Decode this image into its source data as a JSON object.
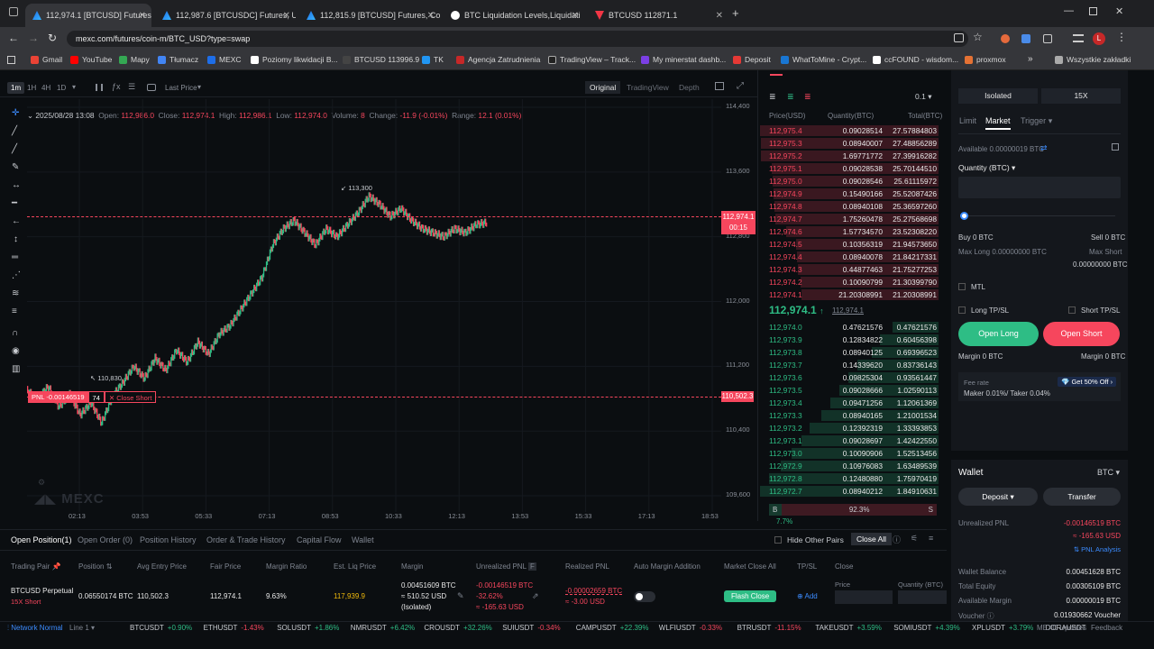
{
  "browser": {
    "tabs": [
      {
        "label": "112,974.1 [BTCUSD] Futures, Co",
        "icon": "mexc-icon",
        "active": true
      },
      {
        "label": "112,987.6 [BTCUSDC] Futures, U",
        "icon": "mexc-icon",
        "active": false
      },
      {
        "label": "112,815.9 [BTCUSD] Futures, Co",
        "icon": "mexc-icon",
        "active": false
      },
      {
        "label": "BTC Liquidation Levels,Liquidati",
        "icon": "coinglass-icon",
        "active": false
      },
      {
        "label": "BTCUSD 112871.1",
        "icon": "tradingview-icon",
        "active": false
      }
    ],
    "url": "mexc.com/futures/coin-m/BTC_USD?type=swap",
    "bookmarks": [
      "Gmail",
      "YouTube",
      "Mapy",
      "Tłumacz",
      "MEXC",
      "Poziomy likwidacji B...",
      "BTCUSD 113996.9",
      "TK",
      "Agencja Zatrudnienia",
      "TradingView – Track...",
      "My minerstat dashb...",
      "Deposit",
      "WhatToMine - Crypt...",
      "ccFOUND - wisdom...",
      "proxmox"
    ],
    "bookmarks_folder": "Wszystkie zakładki"
  },
  "chart": {
    "toolbar": {
      "intervals": [
        "1m",
        "1H",
        "4H",
        "1D"
      ],
      "price_type": "Last Price",
      "views": [
        "Original",
        "TradingView",
        "Depth"
      ]
    },
    "ohlc": {
      "date": "2025/08/28 13:08",
      "open_label": "Open:",
      "open": "112,986.0",
      "close_label": "Close:",
      "close": "112,974.1",
      "high_label": "High:",
      "high": "112,986.1",
      "low_label": "Low:",
      "low": "112,974.0",
      "volume_label": "Volume:",
      "volume": "8",
      "change_label": "Change:",
      "change": "-11.9 (-0.01%)",
      "range_label": "Range:",
      "range": "12.1 (0.01%)"
    },
    "current_price": "112,974.1",
    "countdown": "00:15",
    "high_label": "113,300",
    "low_label": "110,830",
    "position_line": {
      "pnl": "PNL -0.00146519",
      "qty": "74",
      "action": "Close Short",
      "price": "110,502.3"
    },
    "watermark": "MEXC",
    "chart_data": {
      "type": "line",
      "ylim": [
        109400,
        114500
      ],
      "y_ticks": [
        "114,400",
        "113,600",
        "112,800",
        "112,000",
        "111,200",
        "110,400",
        "109,600"
      ],
      "x_ticks": [
        "02:13",
        "03:53",
        "05:33",
        "07:13",
        "08:53",
        "10:33",
        "12:13",
        "13:53",
        "15:33",
        "17:13",
        "18:53"
      ],
      "y": [
        110900,
        110800,
        110950,
        110700,
        110850,
        110600,
        110750,
        110500,
        110830,
        111000,
        111200,
        111050,
        111300,
        111150,
        111400,
        111250,
        111500,
        111350,
        111600,
        111700,
        111900,
        112100,
        112300,
        112700,
        112900,
        113000,
        112850,
        112700,
        112900,
        112800,
        112950,
        113100,
        113300,
        113200,
        113050,
        113150,
        113000,
        112900,
        112850,
        112800,
        112900,
        112850,
        112950,
        112974
      ]
    },
    "colors": {
      "up": "#2ebd85",
      "down": "#f6465d"
    }
  },
  "orderbook": {
    "step": "0.1",
    "headers": [
      "Price(USD)",
      "Quantity(BTC)",
      "Total(BTC)"
    ],
    "asks": [
      [
        "112,975.4",
        "0.09028514",
        "27.57884803"
      ],
      [
        "112,975.3",
        "0.08940007",
        "27.48856289"
      ],
      [
        "112,975.2",
        "1.69771772",
        "27.39916282"
      ],
      [
        "112,975.1",
        "0.09028538",
        "25.70144510"
      ],
      [
        "112,975.0",
        "0.09028546",
        "25.61115972"
      ],
      [
        "112,974.9",
        "0.15490166",
        "25.52087426"
      ],
      [
        "112,974.8",
        "0.08940108",
        "25.36597260"
      ],
      [
        "112,974.7",
        "1.75260478",
        "25.27568698"
      ],
      [
        "112,974.6",
        "1.57734570",
        "23.52308220"
      ],
      [
        "112,974.5",
        "0.10356319",
        "21.94573650"
      ],
      [
        "112,974.4",
        "0.08940078",
        "21.84217331"
      ],
      [
        "112,974.3",
        "0.44877463",
        "21.75277253"
      ],
      [
        "112,974.2",
        "0.10090799",
        "21.30399790"
      ],
      [
        "112,974.1",
        "21.20308991",
        "21.20308991"
      ]
    ],
    "last_price": "112,974.1",
    "mark_price": "112,974.1",
    "bids": [
      [
        "112,974.0",
        "0.47621576",
        "0.47621576"
      ],
      [
        "112,973.9",
        "0.12834822",
        "0.60456398"
      ],
      [
        "112,973.8",
        "0.08940125",
        "0.69396523"
      ],
      [
        "112,973.7",
        "0.14339620",
        "0.83736143"
      ],
      [
        "112,973.6",
        "0.09825304",
        "0.93561447"
      ],
      [
        "112,973.5",
        "0.09028666",
        "1.02590113"
      ],
      [
        "112,973.4",
        "0.09471256",
        "1.12061369"
      ],
      [
        "112,973.3",
        "0.08940165",
        "1.21001534"
      ],
      [
        "112,973.2",
        "0.12392319",
        "1.33393853"
      ],
      [
        "112,973.1",
        "0.09028697",
        "1.42422550"
      ],
      [
        "112,973.0",
        "0.10090906",
        "1.52513456"
      ],
      [
        "112,972.9",
        "0.10976083",
        "1.63489539"
      ],
      [
        "112,972.8",
        "0.12480880",
        "1.75970419"
      ],
      [
        "112,972.7",
        "0.08940212",
        "1.84910631"
      ]
    ],
    "ratio": {
      "buy": "7.7%",
      "sell": "92.3%",
      "buy_label": "B",
      "sell_label": "S",
      "buy_fraction": 0.077
    }
  },
  "trade": {
    "margin_mode": "Isolated",
    "leverage": "15X",
    "order_tabs": [
      "Limit",
      "Market",
      "Trigger"
    ],
    "available": "Available 0.00000019 BTC",
    "quantity_label": "Quantity (BTC)",
    "buy": "Buy 0 BTC",
    "sell": "Sell 0 BTC",
    "max_long": "Max Long 0.00000000 BTC",
    "max_short": "Max Short",
    "max_short_val": "0.00000000 BTC",
    "mtl": "MTL",
    "long_tpsl": "Long TP/SL",
    "short_tpsl": "Short TP/SL",
    "open_long": "Open Long",
    "open_short": "Open Short",
    "margin_long": "Margin 0 BTC",
    "margin_short": "Margin 0 BTC",
    "fee_label": "Fee rate",
    "fee": "Maker 0.01%/ Taker 0.04%",
    "fee_promo": "Get 50% Off"
  },
  "wallet": {
    "title": "Wallet",
    "coin": "BTC",
    "deposit": "Deposit",
    "transfer": "Transfer",
    "rows": [
      {
        "label": "Unrealized PNL",
        "value": "-0.00146519 BTC"
      },
      {
        "label": "",
        "value": "≈ -165.63 USD"
      },
      {
        "label": "",
        "value": "PNL Analysis"
      },
      {
        "label": "Wallet Balance",
        "value": "0.00451628 BTC"
      },
      {
        "label": "Total Equity",
        "value": "0.00305109 BTC"
      },
      {
        "label": "Available Margin",
        "value": "0.00000019 BTC"
      },
      {
        "label": "Voucher",
        "value": "0.01930662 Voucher"
      }
    ]
  },
  "positions": {
    "tabs": [
      "Open Position(1)",
      "Open Order (0)",
      "Position History",
      "Order & Trade History",
      "Capital Flow",
      "Wallet"
    ],
    "hide_other": "Hide Other Pairs",
    "close_all": "Close All",
    "headers": [
      "Trading Pair",
      "Position",
      "Avg Entry Price",
      "Fair Price",
      "Margin Ratio",
      "Est. Liq Price",
      "Margin",
      "Unrealized PNL",
      "Realized PNL",
      "Auto Margin Addition",
      "Market Close All",
      "TP/SL",
      "Close"
    ],
    "row": {
      "pair": "BTCUSD Perpetual",
      "side": "15X Short",
      "position": "0.06550174 BTC",
      "entry": "110,502.3",
      "fair": "112,974.1",
      "ratio": "9.63%",
      "liq": "117,939.9",
      "margin1": "0.00451609 BTC",
      "margin2": "≈ 510.52 USD",
      "margin3": "(Isolated)",
      "upnl1": "-0.00146519 BTC",
      "upnl2": "-32.62%",
      "upnl3": "≈ -165.63 USD",
      "rpnl1": "-0.00002659 BTC",
      "rpnl2": "≈ -3.00 USD",
      "flash": "Flash Close",
      "add": "Add",
      "price_label": "Price",
      "qty_label": "Quantity (BTC)"
    }
  },
  "ticker": {
    "network": "Network Normal",
    "line": "Line 1",
    "items": [
      {
        "s": "BTCUSDT",
        "v": "+0.90%",
        "up": true
      },
      {
        "s": "ETHUSDT",
        "v": "-1.43%",
        "up": false
      },
      {
        "s": "SOLUSDT",
        "v": "+1.86%",
        "up": true
      },
      {
        "s": "NMRUSDT",
        "v": "+6.42%",
        "up": true
      },
      {
        "s": "CROUSDT",
        "v": "+32.26%",
        "up": true
      },
      {
        "s": "SUIUSDT",
        "v": "-0.34%",
        "up": false
      },
      {
        "s": "CAMPUSDT",
        "v": "+22.39%",
        "up": true
      },
      {
        "s": "WLFIUSDT",
        "v": "-0.33%",
        "up": false
      },
      {
        "s": "BTRUSDT",
        "v": "-11.15%",
        "up": false
      },
      {
        "s": "TAKEUSDT",
        "v": "+3.59%",
        "up": true
      },
      {
        "s": "SOMIUSDT",
        "v": "+4.39%",
        "up": true
      },
      {
        "s": "XPLUSDT",
        "v": "+3.79%",
        "up": true
      },
      {
        "s": "DORAUSDT",
        "v": "",
        "up": true
      }
    ],
    "updates": "MEXC Updates",
    "feedback": "Feedback"
  }
}
